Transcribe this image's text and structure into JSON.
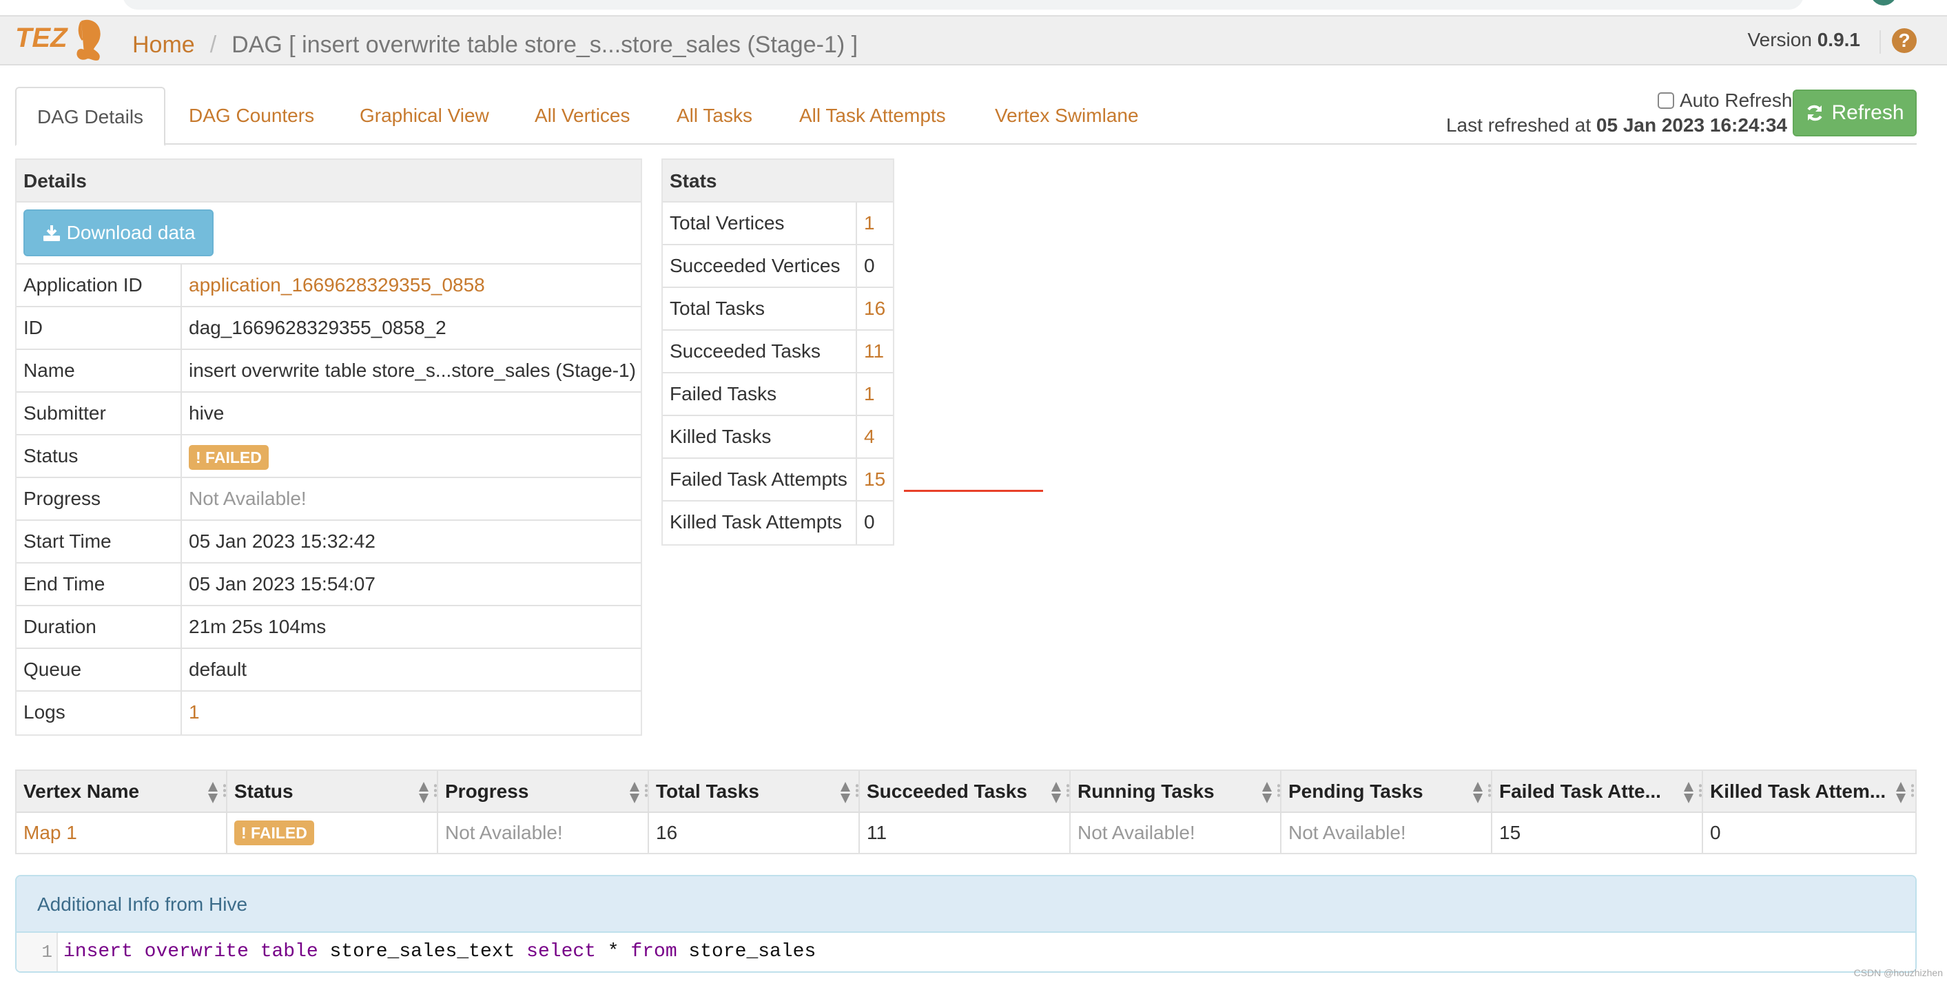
{
  "header": {
    "logo_text": "TEZ",
    "breadcrumb": {
      "home": "Home",
      "separator": "/",
      "current": "DAG [ insert overwrite table store_s...store_sales (Stage-1) ]"
    },
    "version_label": "Version",
    "version_value": "0.9.1",
    "help_icon": "question-circle-icon"
  },
  "tabs": [
    {
      "label": "DAG Details",
      "active": true
    },
    {
      "label": "DAG Counters",
      "active": false
    },
    {
      "label": "Graphical View",
      "active": false
    },
    {
      "label": "All Vertices",
      "active": false
    },
    {
      "label": "All Tasks",
      "active": false
    },
    {
      "label": "All Task Attempts",
      "active": false
    },
    {
      "label": "Vertex Swimlane",
      "active": false
    }
  ],
  "refresh": {
    "auto_refresh_label": "Auto Refresh",
    "auto_refresh_checked": false,
    "last_refreshed_label": "Last refreshed at",
    "last_refreshed_value": "05 Jan 2023 16:24:34",
    "button_label": "Refresh"
  },
  "details": {
    "title": "Details",
    "download_label": "Download data",
    "rows": [
      {
        "key": "Application ID",
        "value": "application_1669628329355_0858",
        "type": "link"
      },
      {
        "key": "ID",
        "value": "dag_1669628329355_0858_2",
        "type": "text"
      },
      {
        "key": "Name",
        "value": "insert overwrite table store_s...store_sales (Stage-1)",
        "type": "text"
      },
      {
        "key": "Submitter",
        "value": "hive",
        "type": "text"
      },
      {
        "key": "Status",
        "value": "! FAILED",
        "type": "badge"
      },
      {
        "key": "Progress",
        "value": "Not Available!",
        "type": "muted"
      },
      {
        "key": "Start Time",
        "value": "05 Jan 2023 15:32:42",
        "type": "text"
      },
      {
        "key": "End Time",
        "value": "05 Jan 2023 15:54:07",
        "type": "text"
      },
      {
        "key": "Duration",
        "value": "21m 25s 104ms",
        "type": "text"
      },
      {
        "key": "Queue",
        "value": "default",
        "type": "text"
      },
      {
        "key": "Logs",
        "value": "1",
        "type": "link"
      }
    ]
  },
  "stats": {
    "title": "Stats",
    "rows": [
      {
        "key": "Total Vertices",
        "value": "1",
        "type": "link"
      },
      {
        "key": "Succeeded Vertices",
        "value": "0",
        "type": "text"
      },
      {
        "key": "Total Tasks",
        "value": "16",
        "type": "link"
      },
      {
        "key": "Succeeded Tasks",
        "value": "11",
        "type": "link"
      },
      {
        "key": "Failed Tasks",
        "value": "1",
        "type": "link"
      },
      {
        "key": "Killed Tasks",
        "value": "4",
        "type": "link"
      },
      {
        "key": "Failed Task Attempts",
        "value": "15",
        "type": "link"
      },
      {
        "key": "Killed Task Attempts",
        "value": "0",
        "type": "text"
      }
    ]
  },
  "vertex_table": {
    "columns": [
      "Vertex Name",
      "Status",
      "Progress",
      "Total Tasks",
      "Succeeded Tasks",
      "Running Tasks",
      "Pending Tasks",
      "Failed Task Atte...",
      "Killed Task Attem..."
    ],
    "rows": [
      [
        {
          "value": "Map 1",
          "type": "link"
        },
        {
          "value": "! FAILED",
          "type": "badge"
        },
        {
          "value": "Not Available!",
          "type": "muted"
        },
        {
          "value": "16",
          "type": "text"
        },
        {
          "value": "11",
          "type": "text"
        },
        {
          "value": "Not Available!",
          "type": "muted"
        },
        {
          "value": "Not Available!",
          "type": "muted"
        },
        {
          "value": "15",
          "type": "text"
        },
        {
          "value": "0",
          "type": "text"
        }
      ]
    ]
  },
  "additional_info": {
    "title": "Additional Info from Hive",
    "line_number": "1",
    "code_tokens": [
      {
        "text": "insert",
        "kw": true
      },
      {
        "text": " ",
        "kw": false
      },
      {
        "text": "overwrite",
        "kw": true
      },
      {
        "text": " ",
        "kw": false
      },
      {
        "text": "table",
        "kw": true
      },
      {
        "text": " store_sales_text ",
        "kw": false
      },
      {
        "text": "select",
        "kw": true
      },
      {
        "text": " * ",
        "kw": false
      },
      {
        "text": "from",
        "kw": true
      },
      {
        "text": " store_sales",
        "kw": false
      }
    ]
  },
  "colors": {
    "accent": "#c77a2e",
    "failed_badge": "#e6ae5e",
    "refresh_button": "#6eb465",
    "download_button": "#74bcdb",
    "annotation_line": "#e8412a"
  },
  "watermark": "CSDN @houzhizhen"
}
